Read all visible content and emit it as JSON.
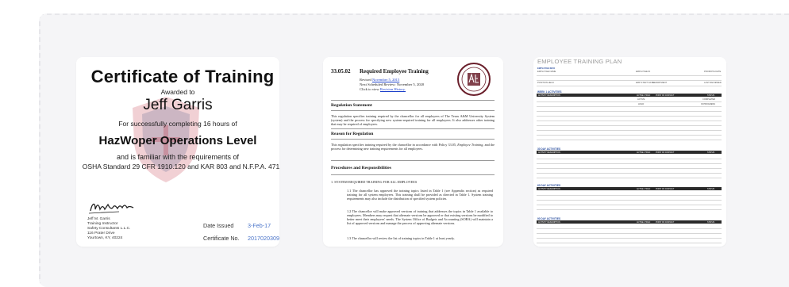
{
  "certificate": {
    "title": "Certificate of Training",
    "awarded": "Awarded to",
    "recipient": "Jeff Garris",
    "for_text": "For successfully completing 16 hours of",
    "course": "HazWoper Operations Level",
    "familiar": "and is familiar with the requirements of",
    "standard": "OSHA Standard 29 CFR 1910.120 and KAR 803 and N.F.P.A. 471",
    "instructor_lines": [
      "Jeff M. Garris",
      "Training Instructor",
      "Safety Consultants L.L.C.",
      "116 Prater Drive",
      "Yourtown, KY, 40224"
    ],
    "date_label": "Date Issued",
    "date_value": "3-Feb-17",
    "cert_label": "Certificate No.",
    "cert_value": "20170203090",
    "colors": {
      "seal": "#c0283a",
      "seal_blue": "#27407a",
      "value_link": "#4a74c9"
    }
  },
  "document": {
    "number": "33.05.02",
    "title": "Required Employee Training",
    "revised_label": "Revised ",
    "revised_link": "November 5, 2015",
    "next_review": "Next Scheduled Review: November 5, 2020",
    "click_label": "Click to view ",
    "click_link": "Revision History.",
    "sections": {
      "regulation_statement": "Regulation Statement",
      "reason": "Reason for Regulation",
      "procedures": "Procedures and Responsibilities"
    },
    "statement_text": "This regulation specifies training required by the chancellor for all employees of The Texas A&M University System (system) and the process for specifying new system-required training for all employees. It also addresses other training that may be required of employees.",
    "reason_text_pre": "This regulation specifies training required by the chancellor in accordance with Policy 33.05, ",
    "reason_text_ital": "Employee Training",
    "reason_text_post": ", and the process for determining new training requirements for all employees.",
    "item1": "1.  SYSTEM-REQUIRED TRAINING FOR ALL EMPLOYEES",
    "p11": "1.1  The chancellor has approved the training topics listed in Table 1 (see Appendix section) as required training for all system employees. This training shall be provided as directed in Table 1. System training requirements may also include the distribution of specified system policies.",
    "p12": "1.2  The chancellor will make approved versions of training that addresses the topics in Table 1 available to employees. Members may request that alternate versions be approved or that existing versions be modified to better meet their employees' needs. The System Office of Budgets and Accounting (SOBA) will maintain a list of approved versions and manage the process of approving alternate versions.",
    "p13": "1.3  The chancellor will review the list of training topics in Table 1 at least yearly."
  },
  "plan": {
    "title": "EMPLOYEE TRAINING PLAN",
    "employee_info": "EMPLOYEE INFO",
    "employee_name": "EMPLOYEE NAME",
    "employee_id": "EMPLOYEE ID",
    "promote_date": "PROMOTE DATE",
    "position_held": "POSITION HELD",
    "start_date": "EMP START DATE",
    "department": "DEPARTMENT",
    "last_review": "LAST REVIEWED",
    "week1": "WEEK 1 ACTIVITIES",
    "d30": "30 DAY ACTIVITIES",
    "d60": "60 DAY ACTIVITIES",
    "d90": "90 DAY ACTIVITIES",
    "col_activity": "ACTIVITY DESCRIPTION",
    "col_active": "ACTIVE / HOLD",
    "col_contact": "POINT OF CONTACT",
    "col_status": "STATUS",
    "cells": {
      "active": "ACTIVE",
      "hold": "HOLD",
      "completed": "COMPLETED",
      "in_progress": "IN PROGRESS"
    }
  }
}
